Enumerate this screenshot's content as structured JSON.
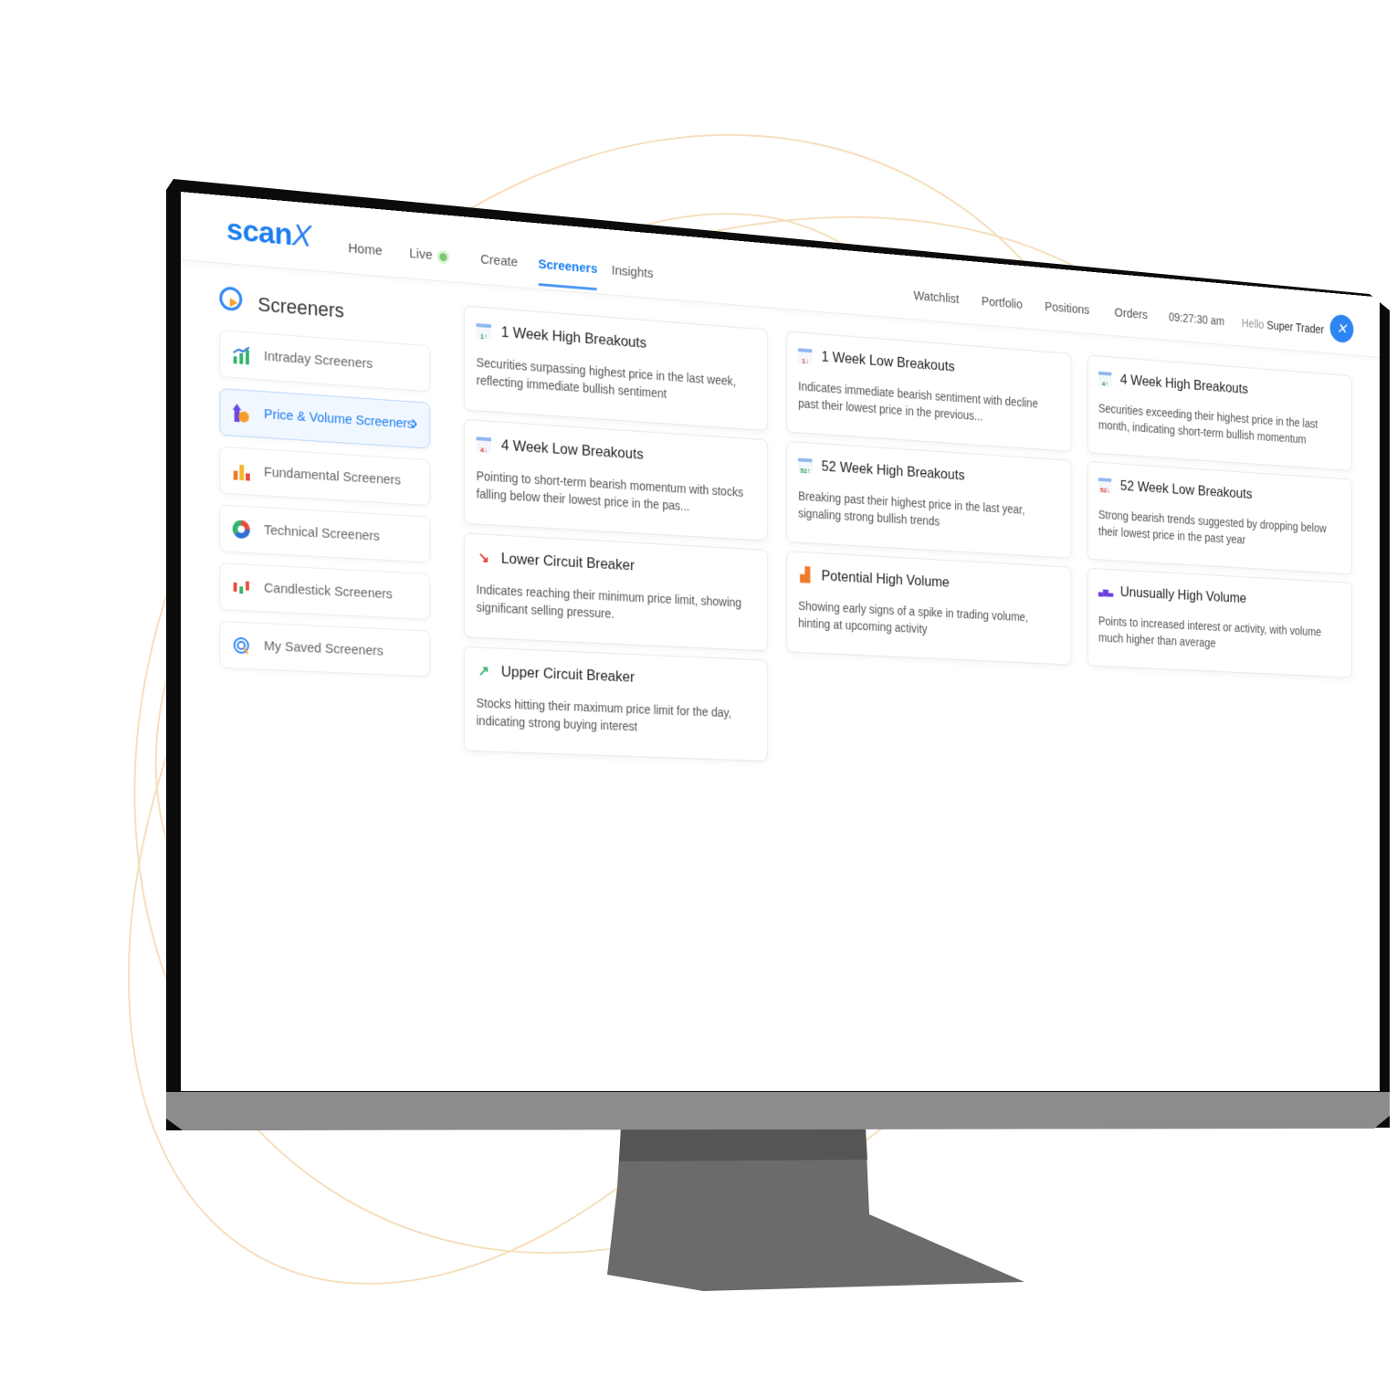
{
  "brand": {
    "logo_text": "scan",
    "logo_mark": "X",
    "accent": "#1a7df0"
  },
  "nav": {
    "left": [
      {
        "label": "Home"
      },
      {
        "label": "Live",
        "indicator": "green-dot"
      },
      {
        "label": "Create"
      },
      {
        "label": "Screeners",
        "active": true
      },
      {
        "label": "Insights"
      }
    ],
    "right": [
      {
        "label": "Watchlist"
      },
      {
        "label": "Portfolio"
      },
      {
        "label": "Positions"
      },
      {
        "label": "Orders"
      }
    ],
    "time": "09:27:30 am",
    "greeting": "Hello",
    "user": "Super Trader",
    "avatar_icon": "scanx-x-icon"
  },
  "sidebar": {
    "title": "Screeners",
    "title_icon": "target-cursor-icon",
    "items": [
      {
        "label": "Intraday Screeners",
        "icon": "bar-chart-up-icon"
      },
      {
        "label": "Price & Volume Screeners",
        "icon": "price-volume-icon",
        "active": true
      },
      {
        "label": "Fundamental Screeners",
        "icon": "bars-icon"
      },
      {
        "label": "Technical Screeners",
        "icon": "pie-chart-icon"
      },
      {
        "label": "Candlestick Screeners",
        "icon": "candlestick-icon"
      },
      {
        "label": "My Saved Screeners",
        "icon": "saved-target-icon"
      }
    ]
  },
  "cards": [
    {
      "col": 0,
      "row": 0,
      "title": "1 Week High Breakouts",
      "desc": "Securities surpassing highest price in the last week, reflecting immediate bullish sentiment",
      "icon": "calendar-1-up-icon",
      "badge": "1↑"
    },
    {
      "col": 0,
      "row": 1,
      "title": "4 Week Low Breakouts",
      "desc": "Pointing to short-term bearish momentum with stocks falling below their lowest price in the pas...",
      "icon": "calendar-4-down-icon",
      "badge": "4↓"
    },
    {
      "col": 0,
      "row": 2,
      "title": "Lower Circuit Breaker",
      "desc": "Indicates reaching their minimum price limit, showing significant selling pressure.",
      "icon": "trend-down-icon",
      "glyph": "↘"
    },
    {
      "col": 0,
      "row": 3,
      "title": "Upper Circuit Breaker",
      "desc": "Stocks hitting their maximum price limit for the day, indicating strong buying interest",
      "icon": "trend-up-icon",
      "glyph": "↗"
    },
    {
      "col": 1,
      "row": 0,
      "title": "1 Week Low Breakouts",
      "desc": "Indicates immediate bearish sentiment with decline past their lowest price in the previous...",
      "icon": "calendar-1-down-icon",
      "badge": "1↓"
    },
    {
      "col": 1,
      "row": 1,
      "title": "52 Week High Breakouts",
      "desc": "Breaking past their highest price in the last year, signaling strong bullish trends",
      "icon": "calendar-52-up-icon",
      "badge": "52↑"
    },
    {
      "col": 1,
      "row": 2,
      "title": "Potential High Volume",
      "desc": "Showing early signs of a spike in trading volume, hinting at upcoming activity",
      "icon": "volume-bars-icon",
      "glyph": "▟"
    },
    {
      "col": 2,
      "row": 0,
      "title": "4 Week High Breakouts",
      "desc": "Securities exceeding their highest price in the last month, indicating short-term bullish momentum",
      "icon": "calendar-4-up-icon",
      "badge": "4↑"
    },
    {
      "col": 2,
      "row": 1,
      "title": "52 Week Low Breakouts",
      "desc": "Strong bearish trends suggested by dropping below their lowest price in the past year",
      "icon": "calendar-52-down-icon",
      "badge": "52↓"
    },
    {
      "col": 2,
      "row": 2,
      "title": "Unusually High Volume",
      "desc": "Points to increased interest or activity, with volume much higher than average",
      "icon": "purple-bars-icon",
      "glyph": "▄▆▃"
    }
  ]
}
